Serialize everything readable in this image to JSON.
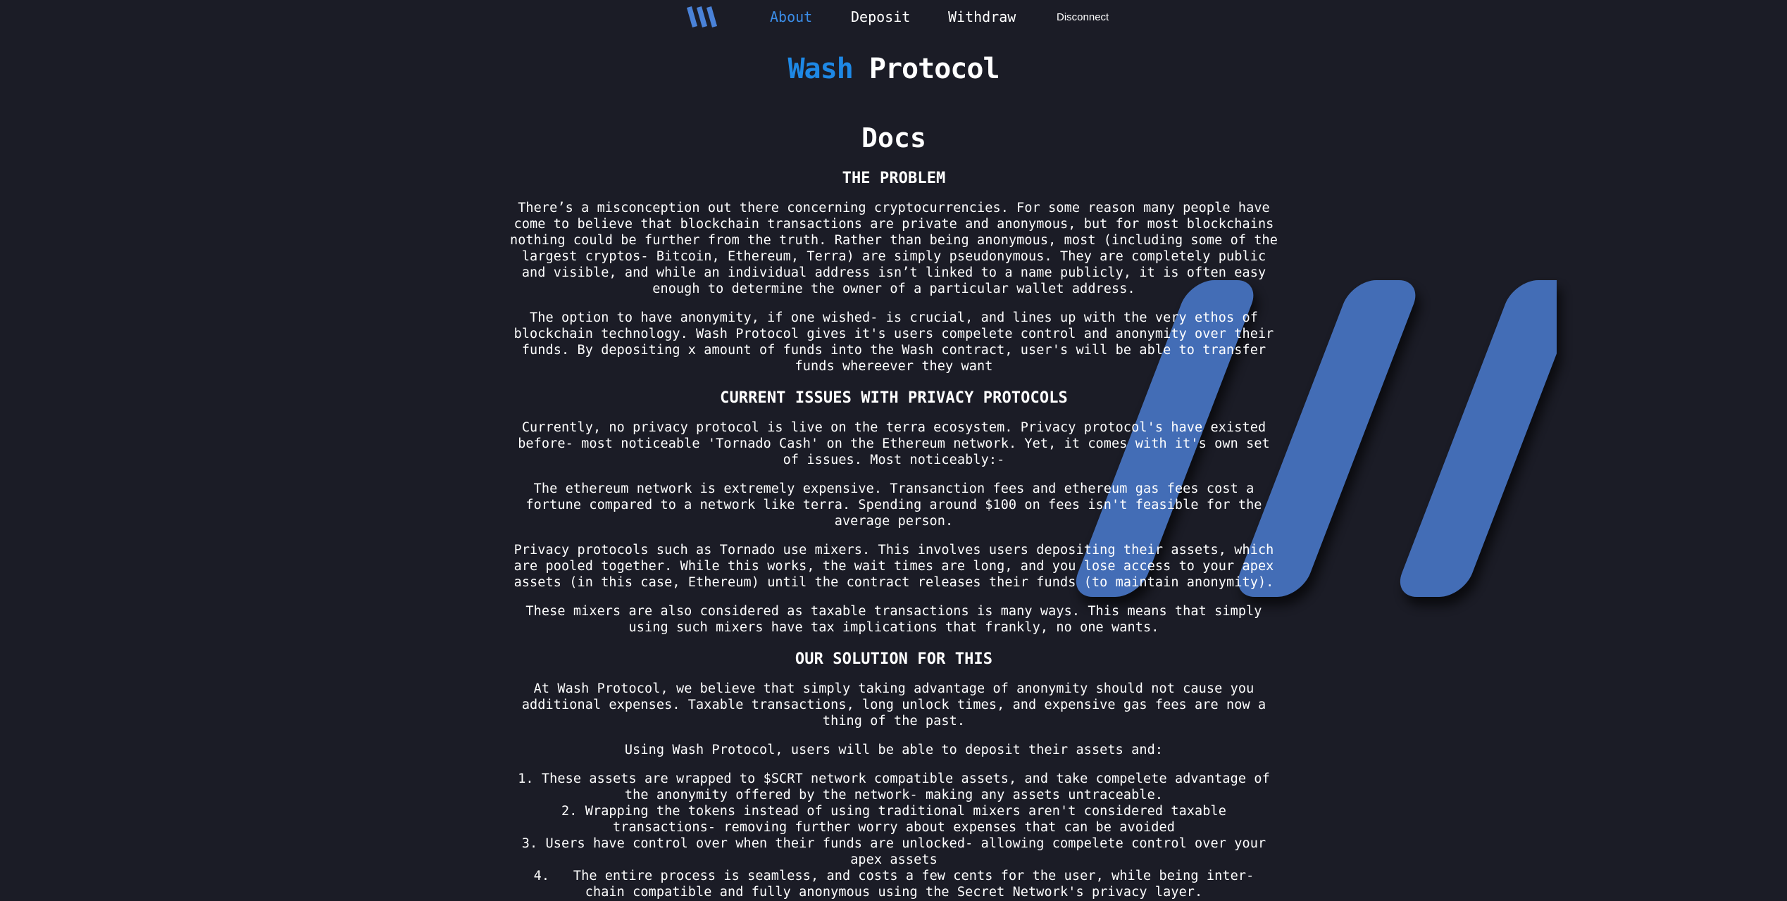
{
  "nav": {
    "logo_icon": "wash-logo-icon",
    "about": "About",
    "deposit": "Deposit",
    "withdraw": "Withdraw",
    "disconnect": "Disconnect",
    "active": "About"
  },
  "title": {
    "part1": "Wash",
    "part2": "Protocol"
  },
  "colors": {
    "background": "#1b1c26",
    "accent_blue": "#1e88e5",
    "nav_active": "#3b8de8",
    "logo_blue": "#4070c0"
  },
  "docs": {
    "heading": "Docs",
    "problem_heading": "THE PROBLEM",
    "problem_p1": "There’s a misconception out there concerning cryptocurrencies. For some reason many people have come to believe that blockchain transactions are private and anonymous, but for most blockchains nothing could be further from the truth. Rather than being anonymous, most (including some of the largest cryptos- Bitcoin, Ethereum, Terra) are simply pseudonymous. They are completely public and visible, and while an individual address isn’t linked to a name publicly, it is often easy enough to determine the owner of a particular wallet address.",
    "problem_p2": "The option to have anonymity, if one wished- is crucial, and lines up with the very ethos of blockchain technology. Wash Protocol gives it's users compelete control and anonymity over their funds. By depositing x amount of funds into the Wash contract, user's will be able to transfer funds whereever they want",
    "issues_heading": "CURRENT ISSUES WITH PRIVACY PROTOCOLS",
    "issues_p1": "Currently, no privacy protocol is live on the terra ecosystem. Privacy protocol's have existed before- most noticeable 'Tornado Cash' on the Ethereum network. Yet, it comes with it's own set of issues. Most noticeably:-",
    "issues_p2": "The ethereum network is extremely expensive. Transanction fees and ethereum gas fees cost a fortune compared to a network like terra. Spending around $100 on fees isn't feasible for the average person.",
    "issues_p3": "Privacy protocols such as Tornado use mixers. This involves users depositing their assets, which are pooled together. While this works, the wait times are long, and you lose access to your apex assets (in this case, Ethereum) until the contract releases their funds (to maintain anonymity).",
    "issues_p4": "These mixers are also considered as taxable transactions is many ways. This means that simply using such mixers have tax implications that frankly, no one wants.",
    "solution_heading": "OUR SOLUTION FOR THIS",
    "solution_p1": "At Wash Protocol, we believe that simply taking advantage of anonymity should not cause you additional expenses. Taxable transactions, long unlock times, and expensive gas fees are now a thing of the past.",
    "solution_p2": "Using Wash Protocol, users will be able to deposit their assets and:",
    "list": [
      {
        "num": "1.",
        "text": "These assets are wrapped to $SCRT network compatible assets, and take compelete advantage of the anonymity offered by the network- making any assets untraceable."
      },
      {
        "num": "2.",
        "text": "Wrapping the tokens instead of using traditional mixers aren't considered taxable transactions- removing further worry about expenses that can be avoided"
      },
      {
        "num": "3.",
        "text": "Users have control over when their funds are unlocked- allowing compelete control over your apex assets"
      },
      {
        "num": "4.",
        "text": "The entire process is seamless, and costs a few cents for the user, while being inter-chain compatible and fully anonymous using the Secret Network's privacy layer."
      }
    ]
  },
  "background_logo_icon": "wash-logo-large-icon"
}
